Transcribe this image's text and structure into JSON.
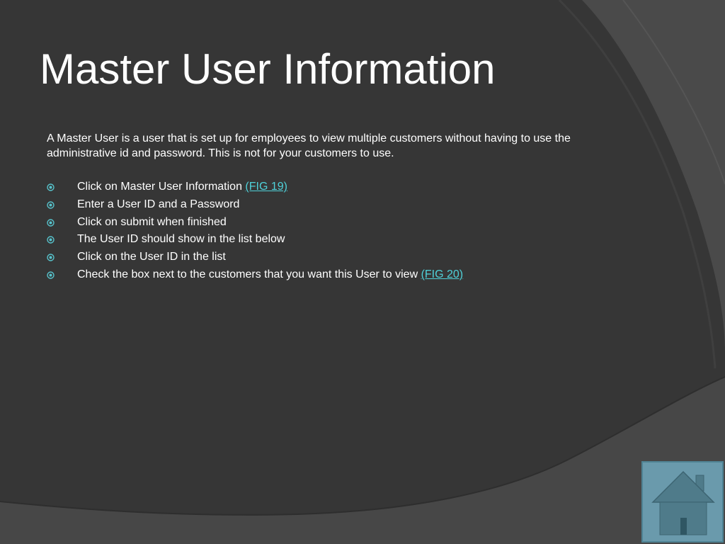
{
  "slide": {
    "title": "Master User Information",
    "intro": "A Master User is a user that is set up for employees to view multiple customers without having to use the administrative id and password.  This is not for your customers to use.",
    "bullets": [
      {
        "text": "Click on Master User Information ",
        "link": "(FIG 19)"
      },
      {
        "text": "Enter a User ID and a Password",
        "link": ""
      },
      {
        "text": "Click on submit when finished",
        "link": ""
      },
      {
        "text": "The User ID should show in the list below",
        "link": ""
      },
      {
        "text": "Click on the User ID in the list",
        "link": ""
      },
      {
        "text": "Check the box next to the customers that you want this User to view ",
        "link": "(FIG 20)"
      }
    ]
  },
  "icons": {
    "bullet": "circled-dot-bullet-icon",
    "home": "home-icon"
  },
  "colors": {
    "background": "#3a3a3a",
    "text": "#ffffff",
    "link": "#4fd1d9",
    "home_button": "#6a9aac",
    "bullet": "#57c3cc"
  }
}
